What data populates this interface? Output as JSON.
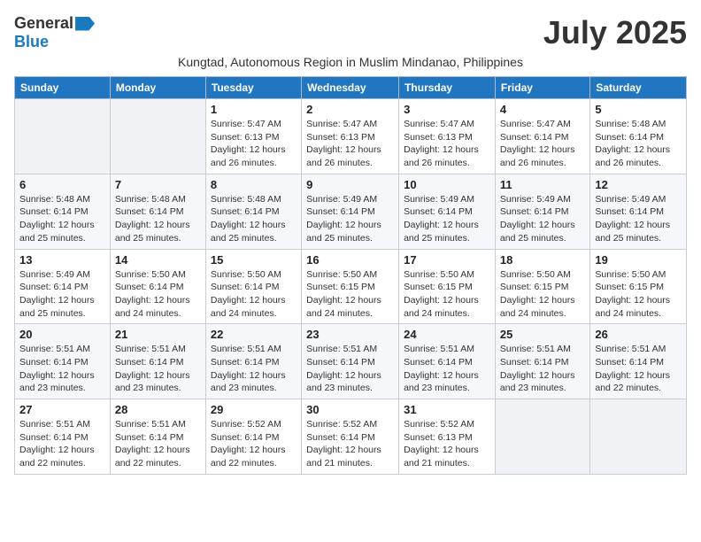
{
  "logo": {
    "general": "General",
    "blue": "Blue"
  },
  "title": "July 2025",
  "subtitle": "Kungtad, Autonomous Region in Muslim Mindanao, Philippines",
  "days_of_week": [
    "Sunday",
    "Monday",
    "Tuesday",
    "Wednesday",
    "Thursday",
    "Friday",
    "Saturday"
  ],
  "weeks": [
    [
      {
        "day": "",
        "info": ""
      },
      {
        "day": "",
        "info": ""
      },
      {
        "day": "1",
        "info": "Sunrise: 5:47 AM\nSunset: 6:13 PM\nDaylight: 12 hours and 26 minutes."
      },
      {
        "day": "2",
        "info": "Sunrise: 5:47 AM\nSunset: 6:13 PM\nDaylight: 12 hours and 26 minutes."
      },
      {
        "day": "3",
        "info": "Sunrise: 5:47 AM\nSunset: 6:13 PM\nDaylight: 12 hours and 26 minutes."
      },
      {
        "day": "4",
        "info": "Sunrise: 5:47 AM\nSunset: 6:14 PM\nDaylight: 12 hours and 26 minutes."
      },
      {
        "day": "5",
        "info": "Sunrise: 5:48 AM\nSunset: 6:14 PM\nDaylight: 12 hours and 26 minutes."
      }
    ],
    [
      {
        "day": "6",
        "info": "Sunrise: 5:48 AM\nSunset: 6:14 PM\nDaylight: 12 hours and 25 minutes."
      },
      {
        "day": "7",
        "info": "Sunrise: 5:48 AM\nSunset: 6:14 PM\nDaylight: 12 hours and 25 minutes."
      },
      {
        "day": "8",
        "info": "Sunrise: 5:48 AM\nSunset: 6:14 PM\nDaylight: 12 hours and 25 minutes."
      },
      {
        "day": "9",
        "info": "Sunrise: 5:49 AM\nSunset: 6:14 PM\nDaylight: 12 hours and 25 minutes."
      },
      {
        "day": "10",
        "info": "Sunrise: 5:49 AM\nSunset: 6:14 PM\nDaylight: 12 hours and 25 minutes."
      },
      {
        "day": "11",
        "info": "Sunrise: 5:49 AM\nSunset: 6:14 PM\nDaylight: 12 hours and 25 minutes."
      },
      {
        "day": "12",
        "info": "Sunrise: 5:49 AM\nSunset: 6:14 PM\nDaylight: 12 hours and 25 minutes."
      }
    ],
    [
      {
        "day": "13",
        "info": "Sunrise: 5:49 AM\nSunset: 6:14 PM\nDaylight: 12 hours and 25 minutes."
      },
      {
        "day": "14",
        "info": "Sunrise: 5:50 AM\nSunset: 6:14 PM\nDaylight: 12 hours and 24 minutes."
      },
      {
        "day": "15",
        "info": "Sunrise: 5:50 AM\nSunset: 6:14 PM\nDaylight: 12 hours and 24 minutes."
      },
      {
        "day": "16",
        "info": "Sunrise: 5:50 AM\nSunset: 6:15 PM\nDaylight: 12 hours and 24 minutes."
      },
      {
        "day": "17",
        "info": "Sunrise: 5:50 AM\nSunset: 6:15 PM\nDaylight: 12 hours and 24 minutes."
      },
      {
        "day": "18",
        "info": "Sunrise: 5:50 AM\nSunset: 6:15 PM\nDaylight: 12 hours and 24 minutes."
      },
      {
        "day": "19",
        "info": "Sunrise: 5:50 AM\nSunset: 6:15 PM\nDaylight: 12 hours and 24 minutes."
      }
    ],
    [
      {
        "day": "20",
        "info": "Sunrise: 5:51 AM\nSunset: 6:14 PM\nDaylight: 12 hours and 23 minutes."
      },
      {
        "day": "21",
        "info": "Sunrise: 5:51 AM\nSunset: 6:14 PM\nDaylight: 12 hours and 23 minutes."
      },
      {
        "day": "22",
        "info": "Sunrise: 5:51 AM\nSunset: 6:14 PM\nDaylight: 12 hours and 23 minutes."
      },
      {
        "day": "23",
        "info": "Sunrise: 5:51 AM\nSunset: 6:14 PM\nDaylight: 12 hours and 23 minutes."
      },
      {
        "day": "24",
        "info": "Sunrise: 5:51 AM\nSunset: 6:14 PM\nDaylight: 12 hours and 23 minutes."
      },
      {
        "day": "25",
        "info": "Sunrise: 5:51 AM\nSunset: 6:14 PM\nDaylight: 12 hours and 23 minutes."
      },
      {
        "day": "26",
        "info": "Sunrise: 5:51 AM\nSunset: 6:14 PM\nDaylight: 12 hours and 22 minutes."
      }
    ],
    [
      {
        "day": "27",
        "info": "Sunrise: 5:51 AM\nSunset: 6:14 PM\nDaylight: 12 hours and 22 minutes."
      },
      {
        "day": "28",
        "info": "Sunrise: 5:51 AM\nSunset: 6:14 PM\nDaylight: 12 hours and 22 minutes."
      },
      {
        "day": "29",
        "info": "Sunrise: 5:52 AM\nSunset: 6:14 PM\nDaylight: 12 hours and 22 minutes."
      },
      {
        "day": "30",
        "info": "Sunrise: 5:52 AM\nSunset: 6:14 PM\nDaylight: 12 hours and 21 minutes."
      },
      {
        "day": "31",
        "info": "Sunrise: 5:52 AM\nSunset: 6:13 PM\nDaylight: 12 hours and 21 minutes."
      },
      {
        "day": "",
        "info": ""
      },
      {
        "day": "",
        "info": ""
      }
    ]
  ]
}
